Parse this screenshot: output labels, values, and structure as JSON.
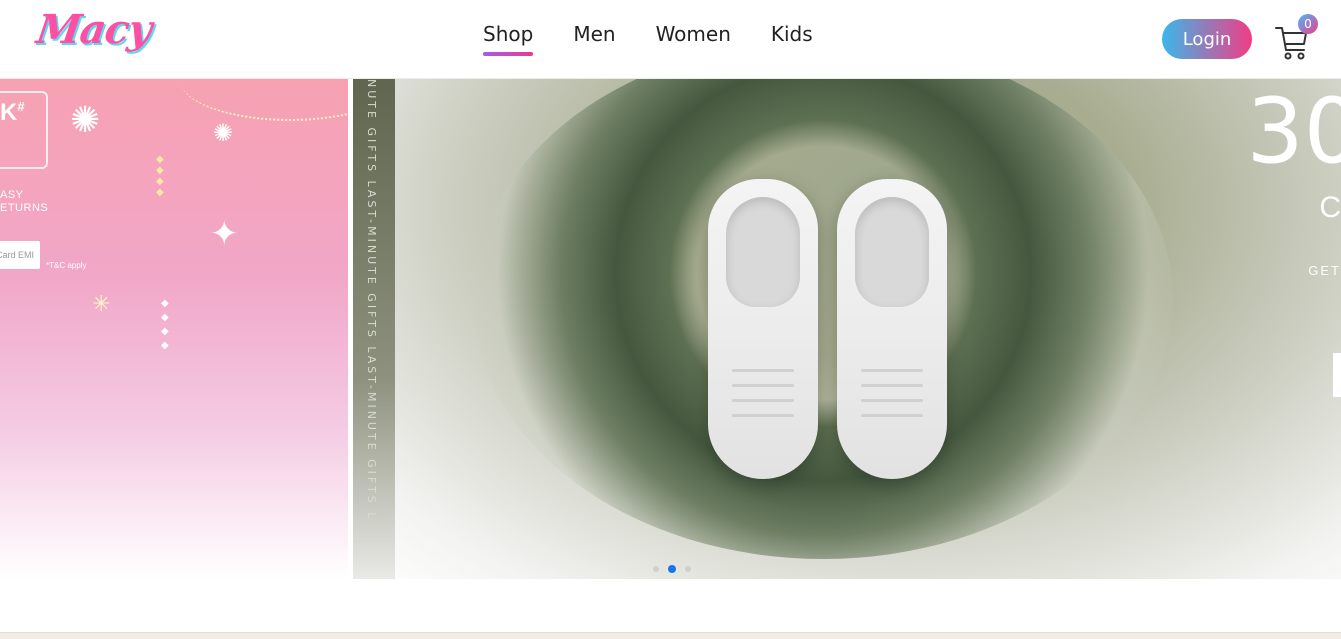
{
  "header": {
    "logo": "Macy",
    "nav": [
      {
        "label": "Shop",
        "active": true
      },
      {
        "label": "Men",
        "active": false
      },
      {
        "label": "Women",
        "active": false
      },
      {
        "label": "Kids",
        "active": false
      }
    ],
    "login_label": "Login",
    "cart_count": "0",
    "cart_icon": "cart-icon"
  },
  "hero": {
    "left_banner": {
      "badge": "K",
      "badge_sup": "#",
      "returns": "ASY\nETURNS",
      "emi": "Card EMI",
      "tc": "*T&C apply"
    },
    "main_banner": {
      "vertical_text": "NUTE GIFTS    LAST-MINUTE GIFTS    LAST-MINUTE GIFTS    L",
      "big_number": "30",
      "sub_letter": "C",
      "get_text": "GET"
    },
    "carousel": {
      "slides": 3,
      "active_index": 1
    }
  },
  "colors": {
    "accent_gradient_start": "#3bb7ea",
    "accent_gradient_end": "#f23c85",
    "logo_pink": "#ff4fa3",
    "active_dot": "#1a73e8"
  }
}
